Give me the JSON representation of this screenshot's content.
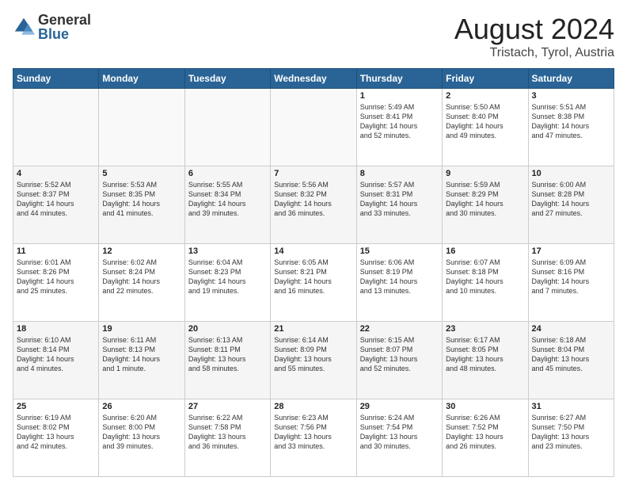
{
  "logo": {
    "general": "General",
    "blue": "Blue"
  },
  "header": {
    "month": "August 2024",
    "location": "Tristach, Tyrol, Austria"
  },
  "days_of_week": [
    "Sunday",
    "Monday",
    "Tuesday",
    "Wednesday",
    "Thursday",
    "Friday",
    "Saturday"
  ],
  "weeks": [
    [
      {
        "day": "",
        "info": ""
      },
      {
        "day": "",
        "info": ""
      },
      {
        "day": "",
        "info": ""
      },
      {
        "day": "",
        "info": ""
      },
      {
        "day": "1",
        "info": "Sunrise: 5:49 AM\nSunset: 8:41 PM\nDaylight: 14 hours\nand 52 minutes."
      },
      {
        "day": "2",
        "info": "Sunrise: 5:50 AM\nSunset: 8:40 PM\nDaylight: 14 hours\nand 49 minutes."
      },
      {
        "day": "3",
        "info": "Sunrise: 5:51 AM\nSunset: 8:38 PM\nDaylight: 14 hours\nand 47 minutes."
      }
    ],
    [
      {
        "day": "4",
        "info": "Sunrise: 5:52 AM\nSunset: 8:37 PM\nDaylight: 14 hours\nand 44 minutes."
      },
      {
        "day": "5",
        "info": "Sunrise: 5:53 AM\nSunset: 8:35 PM\nDaylight: 14 hours\nand 41 minutes."
      },
      {
        "day": "6",
        "info": "Sunrise: 5:55 AM\nSunset: 8:34 PM\nDaylight: 14 hours\nand 39 minutes."
      },
      {
        "day": "7",
        "info": "Sunrise: 5:56 AM\nSunset: 8:32 PM\nDaylight: 14 hours\nand 36 minutes."
      },
      {
        "day": "8",
        "info": "Sunrise: 5:57 AM\nSunset: 8:31 PM\nDaylight: 14 hours\nand 33 minutes."
      },
      {
        "day": "9",
        "info": "Sunrise: 5:59 AM\nSunset: 8:29 PM\nDaylight: 14 hours\nand 30 minutes."
      },
      {
        "day": "10",
        "info": "Sunrise: 6:00 AM\nSunset: 8:28 PM\nDaylight: 14 hours\nand 27 minutes."
      }
    ],
    [
      {
        "day": "11",
        "info": "Sunrise: 6:01 AM\nSunset: 8:26 PM\nDaylight: 14 hours\nand 25 minutes."
      },
      {
        "day": "12",
        "info": "Sunrise: 6:02 AM\nSunset: 8:24 PM\nDaylight: 14 hours\nand 22 minutes."
      },
      {
        "day": "13",
        "info": "Sunrise: 6:04 AM\nSunset: 8:23 PM\nDaylight: 14 hours\nand 19 minutes."
      },
      {
        "day": "14",
        "info": "Sunrise: 6:05 AM\nSunset: 8:21 PM\nDaylight: 14 hours\nand 16 minutes."
      },
      {
        "day": "15",
        "info": "Sunrise: 6:06 AM\nSunset: 8:19 PM\nDaylight: 14 hours\nand 13 minutes."
      },
      {
        "day": "16",
        "info": "Sunrise: 6:07 AM\nSunset: 8:18 PM\nDaylight: 14 hours\nand 10 minutes."
      },
      {
        "day": "17",
        "info": "Sunrise: 6:09 AM\nSunset: 8:16 PM\nDaylight: 14 hours\nand 7 minutes."
      }
    ],
    [
      {
        "day": "18",
        "info": "Sunrise: 6:10 AM\nSunset: 8:14 PM\nDaylight: 14 hours\nand 4 minutes."
      },
      {
        "day": "19",
        "info": "Sunrise: 6:11 AM\nSunset: 8:13 PM\nDaylight: 14 hours\nand 1 minute."
      },
      {
        "day": "20",
        "info": "Sunrise: 6:13 AM\nSunset: 8:11 PM\nDaylight: 13 hours\nand 58 minutes."
      },
      {
        "day": "21",
        "info": "Sunrise: 6:14 AM\nSunset: 8:09 PM\nDaylight: 13 hours\nand 55 minutes."
      },
      {
        "day": "22",
        "info": "Sunrise: 6:15 AM\nSunset: 8:07 PM\nDaylight: 13 hours\nand 52 minutes."
      },
      {
        "day": "23",
        "info": "Sunrise: 6:17 AM\nSunset: 8:05 PM\nDaylight: 13 hours\nand 48 minutes."
      },
      {
        "day": "24",
        "info": "Sunrise: 6:18 AM\nSunset: 8:04 PM\nDaylight: 13 hours\nand 45 minutes."
      }
    ],
    [
      {
        "day": "25",
        "info": "Sunrise: 6:19 AM\nSunset: 8:02 PM\nDaylight: 13 hours\nand 42 minutes."
      },
      {
        "day": "26",
        "info": "Sunrise: 6:20 AM\nSunset: 8:00 PM\nDaylight: 13 hours\nand 39 minutes."
      },
      {
        "day": "27",
        "info": "Sunrise: 6:22 AM\nSunset: 7:58 PM\nDaylight: 13 hours\nand 36 minutes."
      },
      {
        "day": "28",
        "info": "Sunrise: 6:23 AM\nSunset: 7:56 PM\nDaylight: 13 hours\nand 33 minutes."
      },
      {
        "day": "29",
        "info": "Sunrise: 6:24 AM\nSunset: 7:54 PM\nDaylight: 13 hours\nand 30 minutes."
      },
      {
        "day": "30",
        "info": "Sunrise: 6:26 AM\nSunset: 7:52 PM\nDaylight: 13 hours\nand 26 minutes."
      },
      {
        "day": "31",
        "info": "Sunrise: 6:27 AM\nSunset: 7:50 PM\nDaylight: 13 hours\nand 23 minutes."
      }
    ]
  ]
}
